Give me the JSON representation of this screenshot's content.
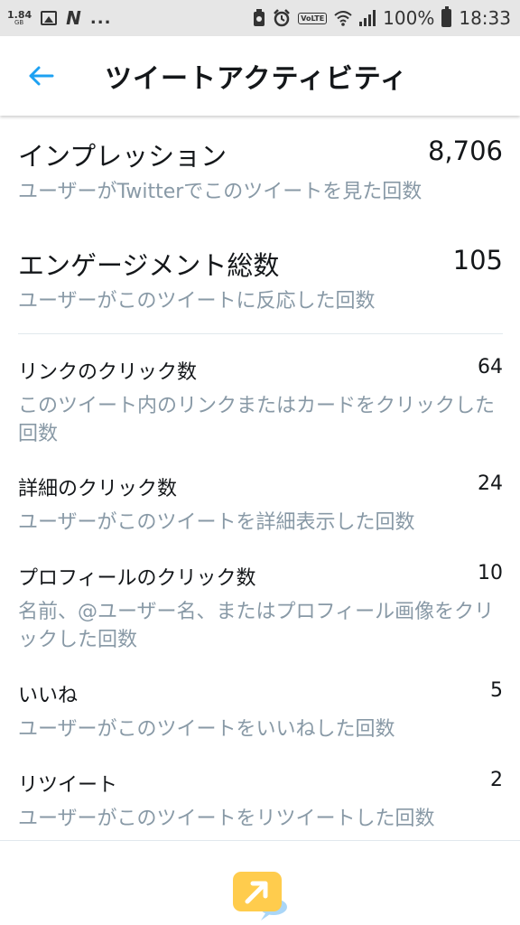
{
  "status_bar": {
    "speed": "1.84",
    "speed_unit": "GB",
    "app_initial": "N",
    "more": "...",
    "volte": "VoLTE",
    "battery_percent": "100%",
    "time": "18:33"
  },
  "header": {
    "back_icon": "arrow-left-icon",
    "title": "ツイートアクティビティ",
    "accent_color": "#1da1f2"
  },
  "summary": [
    {
      "label": "インプレッション",
      "value": "8,706",
      "desc": "ユーザーがTwitterでこのツイートを見た回数"
    },
    {
      "label": "エンゲージメント総数",
      "value": "105",
      "desc": "ユーザーがこのツイートに反応した回数"
    }
  ],
  "metrics": [
    {
      "label": "リンクのクリック数",
      "value": "64",
      "desc": "このツイート内のリンクまたはカードをクリックした回数"
    },
    {
      "label": "詳細のクリック数",
      "value": "24",
      "desc": "ユーザーがこのツイートを詳細表示した回数"
    },
    {
      "label": "プロフィールのクリック数",
      "value": "10",
      "desc": "名前、@ユーザー名、またはプロフィール画像をクリックした回数"
    },
    {
      "label": "いいね",
      "value": "5",
      "desc": "ユーザーがこのツイートをいいねした回数"
    },
    {
      "label": "リツイート",
      "value": "2",
      "desc": "ユーザーがこのツイートをリツイートした回数"
    }
  ],
  "footer": {
    "icon": "promote-tweet-icon",
    "icon_color": "#ffcc4d"
  }
}
